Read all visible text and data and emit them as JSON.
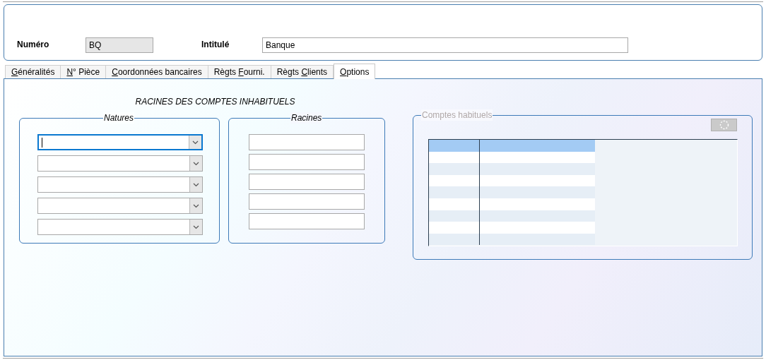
{
  "header": {
    "numero": {
      "label": "Numéro",
      "value": "BQ"
    },
    "intitule": {
      "label": "Intitulé",
      "value": "Banque"
    }
  },
  "tabs": [
    {
      "key": "G",
      "post": "énéralités",
      "selected": false
    },
    {
      "key": "N",
      "post": "° Pièce",
      "selected": false
    },
    {
      "key": "C",
      "post": "oordonnées bancaires",
      "selected": false
    },
    {
      "pre": "Règts ",
      "key": "F",
      "post": "ourni.",
      "selected": false
    },
    {
      "pre": "Règts ",
      "key": "C",
      "post": "lients",
      "selected": false
    },
    {
      "key": "O",
      "post": "ptions",
      "selected": true
    }
  ],
  "section_title": "RACINES DES COMPTES INHABITUELS",
  "natures": {
    "legend": "Natures",
    "combos": [
      {
        "focused": true
      },
      {
        "focused": false
      },
      {
        "focused": false
      },
      {
        "focused": false
      },
      {
        "focused": false
      }
    ]
  },
  "racines": {
    "legend": "Racines",
    "fields": [
      {
        "focused": false
      },
      {
        "focused": false
      },
      {
        "focused": false
      },
      {
        "focused": false
      },
      {
        "focused": false
      }
    ]
  },
  "comptes_habituels": {
    "legend": "Comptes habituels",
    "rows": [
      {
        "selected": true
      },
      {
        "selected": false
      },
      {
        "selected": false
      },
      {
        "selected": false
      },
      {
        "selected": false
      },
      {
        "selected": false
      },
      {
        "selected": false
      },
      {
        "selected": false
      },
      {
        "selected": false
      }
    ]
  }
}
